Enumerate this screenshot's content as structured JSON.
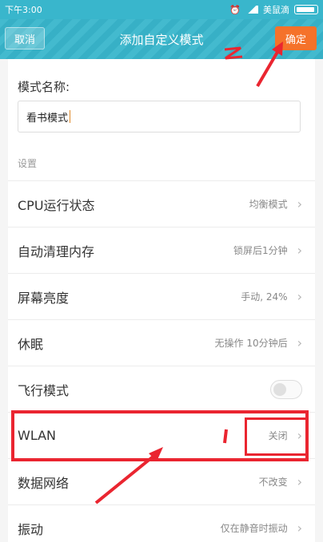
{
  "status": {
    "time": "下午3:00",
    "carrier": "美鼠滴"
  },
  "header": {
    "cancel": "取消",
    "title": "添加自定义模式",
    "confirm": "确定"
  },
  "form": {
    "name_label": "模式名称:",
    "name_value": "看书模式"
  },
  "section": {
    "label": "设置"
  },
  "rows": [
    {
      "label": "CPU运行状态",
      "value": "均衡模式"
    },
    {
      "label": "自动清理内存",
      "value": "锁屏后1分钟"
    },
    {
      "label": "屏幕亮度",
      "value": "手动, 24%"
    },
    {
      "label": "休眠",
      "value": "无操作 10分钟后"
    },
    {
      "label": "飞行模式",
      "value": ""
    },
    {
      "label": "WLAN",
      "value": "关闭"
    },
    {
      "label": "数据网络",
      "value": "不改变"
    },
    {
      "label": "振动",
      "value": "仅在静音时振动"
    }
  ],
  "colors": {
    "accent": "#39b6cc",
    "confirm": "#f5722a",
    "annotation": "#ea2530"
  },
  "annotations": {
    "mark_1": "1",
    "mark_2": "2"
  }
}
